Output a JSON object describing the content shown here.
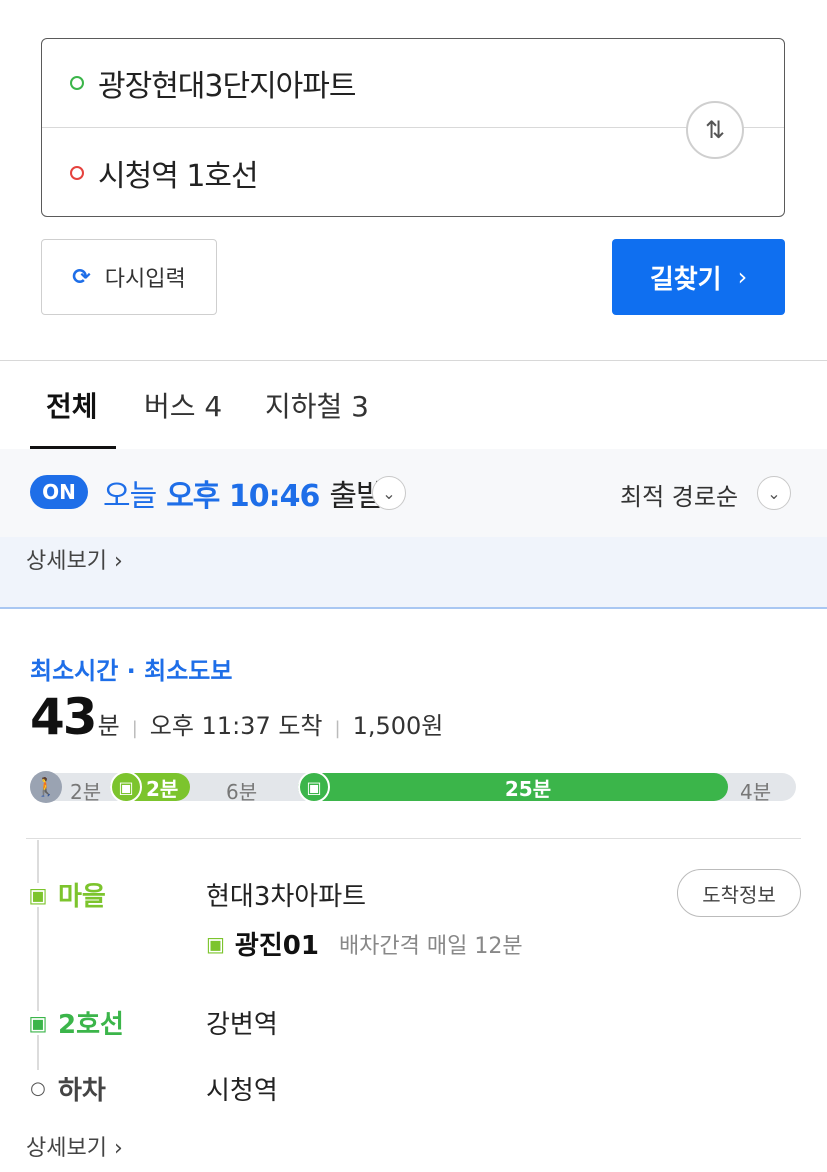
{
  "route": {
    "start": "광장현대3단지아파트",
    "end": "시청역 1호선",
    "swap_icon": "⇅"
  },
  "actions": {
    "reset_label": "다시입력",
    "search_label": "길찾기",
    "search_chevron": "›"
  },
  "tabs": [
    {
      "label": "전체"
    },
    {
      "label": "버스 4"
    },
    {
      "label": "지하철 3"
    }
  ],
  "options": {
    "on_badge": "ON",
    "today": "오늘",
    "time": "오후 10:46",
    "depart": "출발",
    "sort": "최적 경로순",
    "chevron": "⌄"
  },
  "detail_link": "상세보기 ›",
  "result": {
    "tags": "최소시간 · 최소도보",
    "minutes": "43",
    "minute_unit": "분",
    "arrival": "오후 11:37 도착",
    "fare": "1,500원",
    "timeline": {
      "walk1": "2분",
      "bus": "2분",
      "walk2": "6분",
      "subway": "25분",
      "walk3": "4분"
    },
    "steps": [
      {
        "mode": "마을",
        "place": "현대3차아파트"
      },
      {
        "mode": "2호선",
        "place": "강변역"
      },
      {
        "mode": "하차",
        "place": "시청역"
      }
    ],
    "arrive_info": "도착정보",
    "bus_number": "광진01",
    "interval": "배차간격 매일 12분"
  },
  "colors": {
    "accent": "#0f6ff0",
    "bus_green": "#7cc42d",
    "subway_green": "#3bb54a"
  }
}
